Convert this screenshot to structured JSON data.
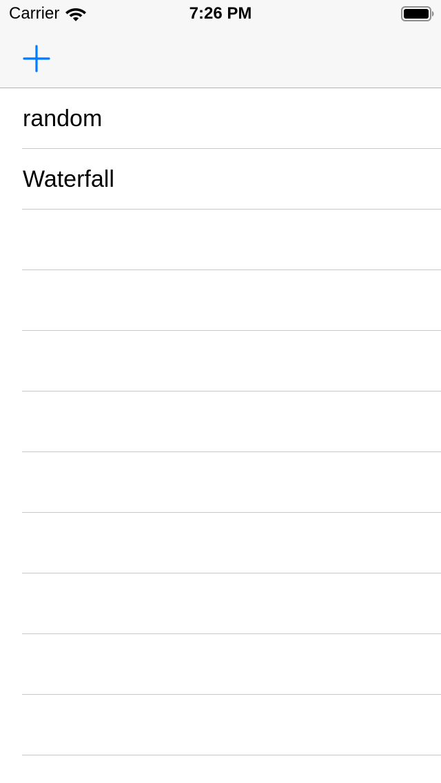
{
  "status_bar": {
    "carrier": "Carrier",
    "time": "7:26 PM",
    "wifi_icon": "wifi-icon",
    "battery_icon": "battery-full-icon"
  },
  "nav_bar": {
    "add_icon": "plus-icon",
    "accent_color": "#007aff"
  },
  "list": {
    "items": [
      {
        "label": "random"
      },
      {
        "label": "Waterfall"
      },
      {
        "label": ""
      },
      {
        "label": ""
      },
      {
        "label": ""
      },
      {
        "label": ""
      },
      {
        "label": ""
      },
      {
        "label": ""
      },
      {
        "label": ""
      },
      {
        "label": ""
      },
      {
        "label": ""
      },
      {
        "label": ""
      }
    ]
  },
  "colors": {
    "bar_background": "#f7f7f7",
    "separator": "#c8c7cc",
    "text": "#000000",
    "background": "#ffffff"
  }
}
